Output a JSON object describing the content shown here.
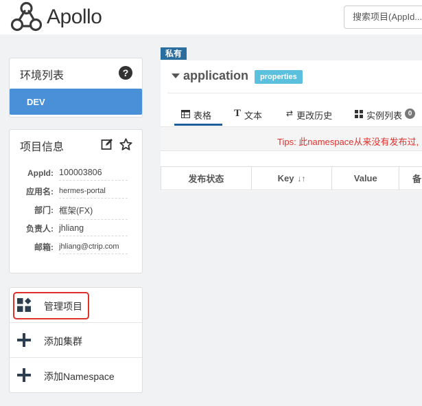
{
  "header": {
    "brand": "Apollo",
    "search_placeholder": "搜索项目(AppId..."
  },
  "sidebar": {
    "env_panel": {
      "title": "环境列表",
      "help_icon": "?",
      "environments": [
        "DEV"
      ]
    },
    "info_panel": {
      "title": "项目信息",
      "fields": [
        {
          "label": "AppId:",
          "value": "100003806"
        },
        {
          "label": "应用名:",
          "value": "hermes-portal"
        },
        {
          "label": "部门:",
          "value": "框架(FX)"
        },
        {
          "label": "负责人:",
          "value": "jhliang"
        },
        {
          "label": "邮箱:",
          "value": "jhliang@ctrip.com"
        }
      ]
    },
    "actions": [
      {
        "label": "管理项目",
        "icon": "manage-grid-icon"
      },
      {
        "label": "添加集群",
        "icon": "plus-icon"
      },
      {
        "label": "添加Namespace",
        "icon": "plus-icon"
      }
    ]
  },
  "namespace": {
    "private_badge": "私有",
    "name": "application",
    "format": "properties",
    "tabs": [
      {
        "label": "表格",
        "icon": "table-icon"
      },
      {
        "label": "文本",
        "icon": "text-icon"
      },
      {
        "label": "更改历史",
        "icon": "history-icon"
      },
      {
        "label": "实例列表",
        "icon": "instances-icon",
        "count": "0"
      }
    ],
    "tips": "Tips: 此namespace从来没有发布过,",
    "table_columns": [
      "发布状态",
      "Key",
      "Value",
      "备"
    ]
  },
  "colors": {
    "accent": "#4a90d9",
    "badge": "#2a6ea0",
    "format_badge": "#5bc0de",
    "highlight": "#e0302b",
    "tips_text": "#e0302b"
  }
}
